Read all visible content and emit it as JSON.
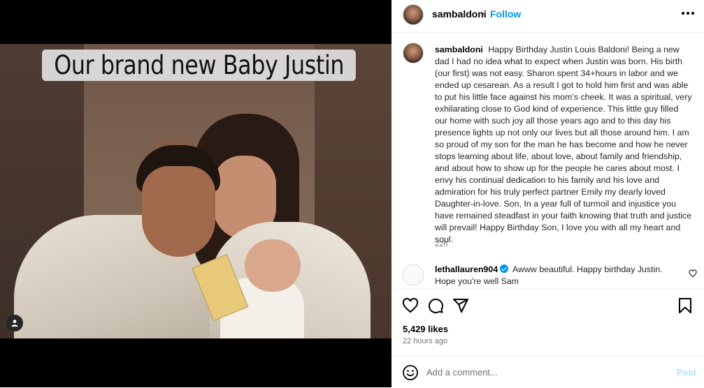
{
  "media": {
    "overlay_text": "Our brand new Baby Justin",
    "tag_icon": "person-tag-icon"
  },
  "header": {
    "username": "sambaldoni",
    "separator": "•",
    "follow_label": "Follow",
    "more_icon": "more-options-icon"
  },
  "caption": {
    "username": "sambaldoni",
    "text": "Happy Birthday Justin Louis Baldoni! Being a new dad I had no idea what to expect when Justin was born. His birth (our first) was not easy. Sharon spent 34+hours in labor and we ended up cesarean. As a result I got to hold him first and was able to put his little face against his mom’s cheek. It was a spiritual, very exhilarating close to God kind of experience. This little guy filled our home with such joy all those years ago and to this day his presence lights up not only our lives but all those around him. I am so proud of my son for the man he has become and how he never stops learning about life, about love, about family and friendship, and about how to show up for the people he cares about most. I envy his continual dedication to his family and his love and admiration for his truly perfect partner Emily my dearly loved Daughter-in-love. Son, In a year full of turmoil and injustice you have remained steadfast in your faith knowing that truth and justice will prevail! Happy Birthday Son, I love you with all my heart and soul.",
    "time": "22h"
  },
  "comments": [
    {
      "username": "lethallauren904",
      "verified": true,
      "text": "Awww beautiful. Happy birthday Justin. Hope you're well Sam"
    }
  ],
  "actions": {
    "like_icon": "heart-icon",
    "comment_icon": "comment-icon",
    "share_icon": "share-icon",
    "save_icon": "bookmark-icon"
  },
  "likes": "5,429 likes",
  "posted_ago": "22 hours ago",
  "add_comment": {
    "placeholder": "Add a comment...",
    "post_label": "Post"
  },
  "colors": {
    "link_blue": "#0095f6",
    "muted_text": "#737373",
    "post_disabled": "#b2dffc"
  }
}
